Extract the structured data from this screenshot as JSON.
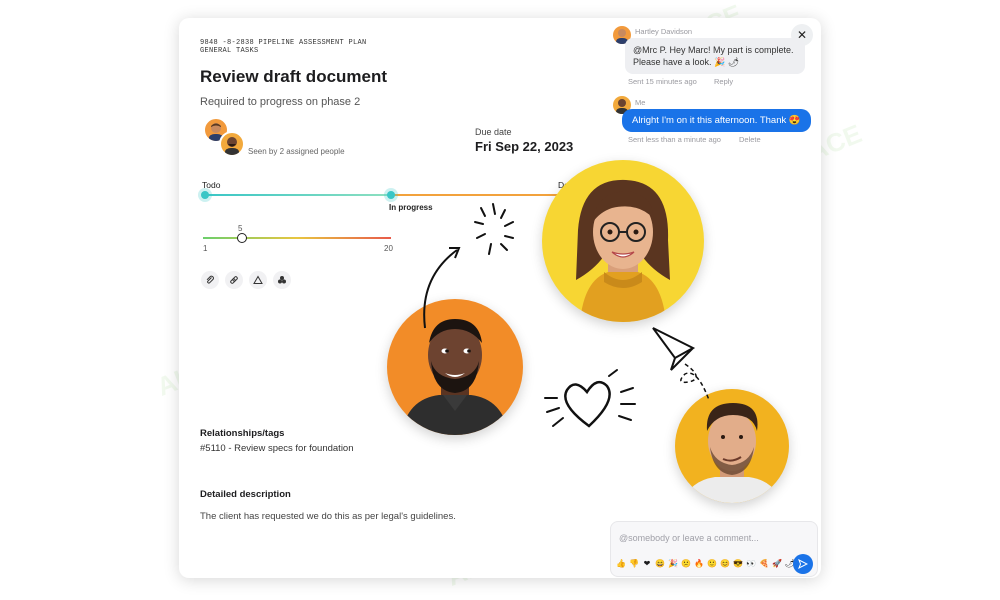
{
  "header": {
    "project_code": "9848 -8-2838 PIPELINE ASSESSMENT PLAN",
    "category": "GENERAL TASKS",
    "title": "Review draft document",
    "subtitle": "Required to progress on phase 2",
    "seen_by": "Seen by 2 assigned people"
  },
  "due": {
    "label": "Due date",
    "value": "Fri Sep 22, 2023"
  },
  "progress": {
    "stages": [
      "Todo",
      "In progress",
      "Do"
    ],
    "current_stage": "In progress"
  },
  "slider": {
    "min_label": "1",
    "max_label": "20",
    "value_label": "5",
    "value": 5,
    "min": 1,
    "max": 20
  },
  "attachments": {
    "icons": [
      "paperclip-icon",
      "link-icon",
      "warning-icon",
      "clover-icon"
    ]
  },
  "relationships": {
    "heading": "Relationships/tags",
    "item": "#5110 - Review specs for foundation"
  },
  "description": {
    "heading": "Detailed description",
    "text": "The client has requested we do this as per legal's guidelines."
  },
  "comments": [
    {
      "author": "Hartley Davidson",
      "text": "@Mrc P. Hey Marc! My part is complete. Please have a look. 🎉 🌶",
      "meta": "Sent 15 minutes ago",
      "action": "Reply"
    },
    {
      "author": "Me",
      "text": "Alright I'm on it this afternoon. Thank 😍",
      "meta": "Sent less than a minute ago",
      "action": "Delete"
    }
  ],
  "composer": {
    "placeholder": "@somebody or leave a comment...",
    "emojis": [
      "👍",
      "👎",
      "❤",
      "😄",
      "🎉",
      "😕",
      "🔥",
      "🙂",
      "😊",
      "😎",
      "👀",
      "🍕",
      "🚀",
      "🌶"
    ]
  },
  "watermark": "AI TALENT SPACE",
  "colors": {
    "accent_blue": "#1a73e8",
    "photo_yellow": "#f7d633",
    "photo_orange": "#f28c28",
    "track_teal": "#39c6c6"
  }
}
